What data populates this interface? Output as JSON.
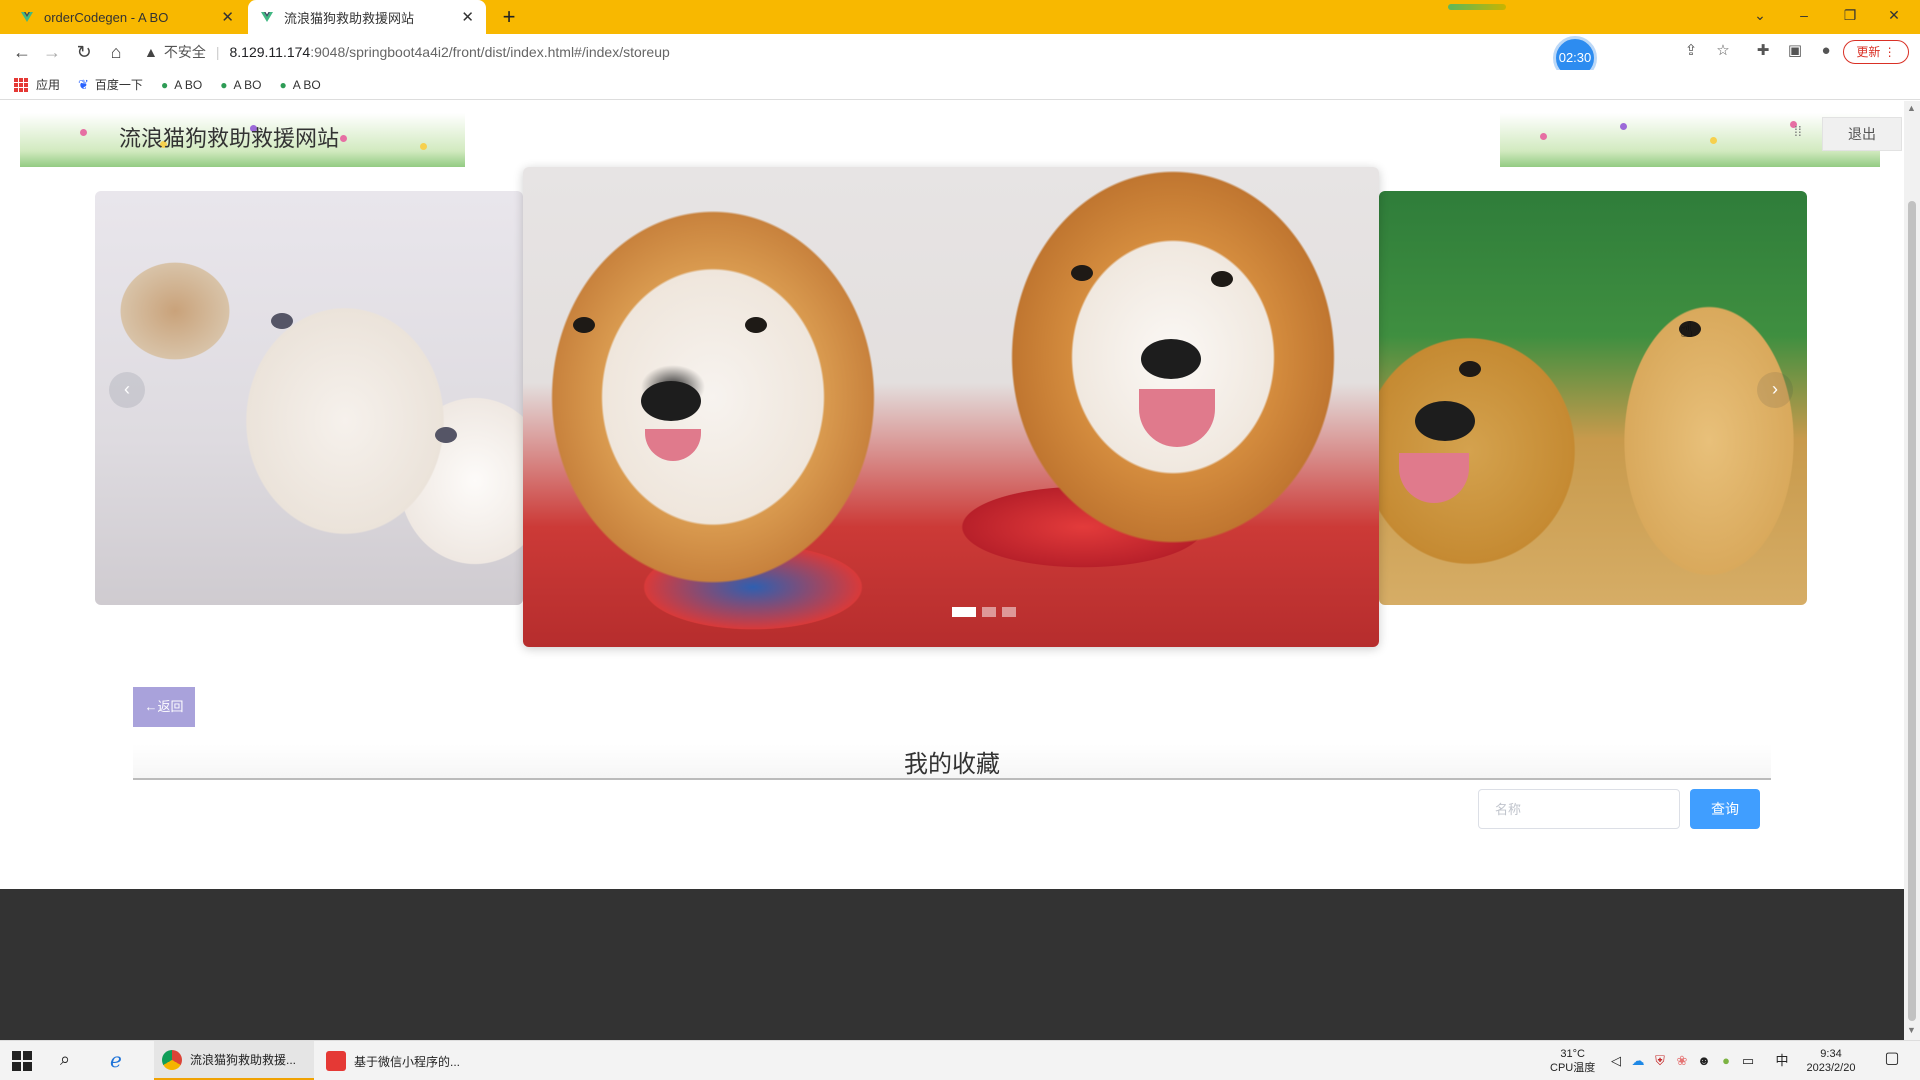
{
  "browser": {
    "tabs": [
      {
        "title": "orderCodegen - A BO",
        "active": false
      },
      {
        "title": "流浪猫狗救助救援网站",
        "active": true
      }
    ],
    "new_tab": "+",
    "window_controls": {
      "chevron": "⌄",
      "minimize": "–",
      "restore": "❐",
      "close": "✕"
    },
    "address": {
      "security_label": "不安全",
      "host": "8.129.11.174",
      "path": ":9048/springboot4a4i2/front/dist/index.html#/index/storeup"
    },
    "timer": "02:30",
    "update_label": "更新",
    "bookmarks": [
      {
        "label": "应用",
        "icon": "apps-grid-icon"
      },
      {
        "label": "百度一下",
        "icon": "baidu-paw-icon"
      },
      {
        "label": "A BO",
        "icon": "leaf-icon"
      },
      {
        "label": "A BO",
        "icon": "leaf-icon"
      },
      {
        "label": "A BO",
        "icon": "leaf-icon"
      }
    ]
  },
  "site": {
    "title": "流浪猫狗救助救援网站",
    "logout_label": "退出"
  },
  "carousel": {
    "slides": [
      "kittens",
      "corgis",
      "golden-retrievers"
    ],
    "active_index": 0,
    "prev_arrow": "‹",
    "next_arrow": "›"
  },
  "content": {
    "back_label": "←返回",
    "section_title": "我的收藏",
    "search_placeholder": "名称",
    "search_value": "",
    "query_label": "查询"
  },
  "taskbar": {
    "items": [
      {
        "label": "流浪猫狗救助救援...",
        "active": true
      },
      {
        "label": "基于微信小程序的...",
        "active": false
      }
    ],
    "temperature": "31°C",
    "cpu_label": "CPU温度",
    "ime": "中",
    "time": "9:34",
    "date": "2023/2/20"
  },
  "colors": {
    "tabbar": "#f8b800",
    "back_button": "#a9a2db",
    "query_button": "#409eff",
    "footer": "#333333"
  }
}
